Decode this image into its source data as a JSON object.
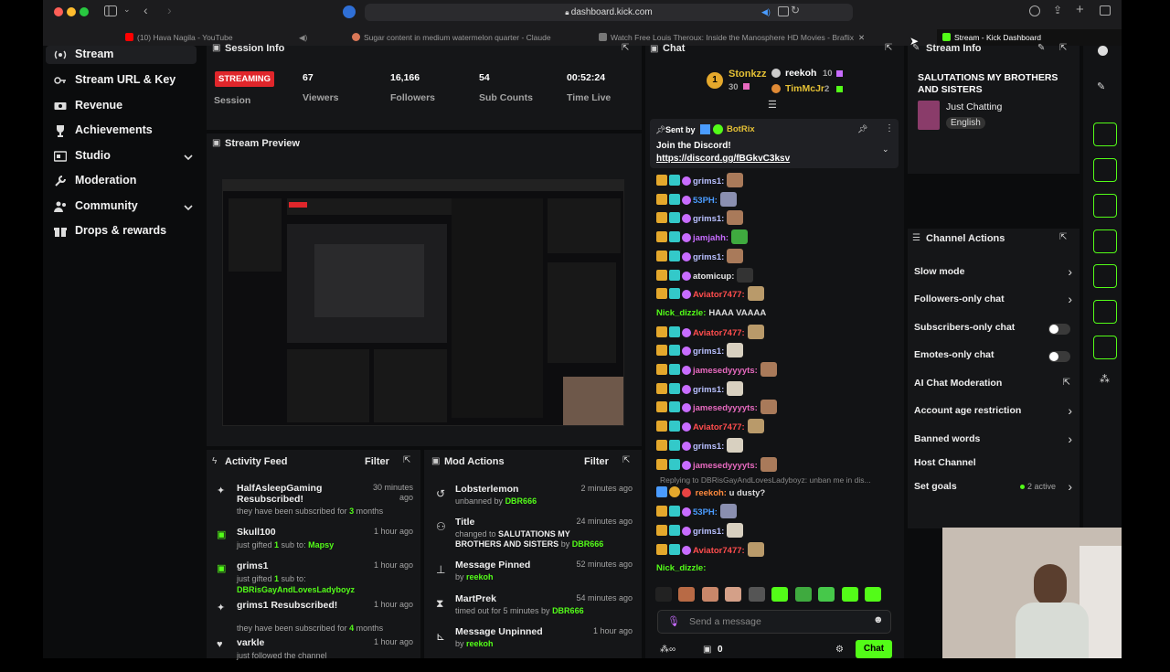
{
  "browser": {
    "url": "dashboard.kick.com",
    "tabs": [
      {
        "label": "(10) Hava Nagila - YouTube"
      },
      {
        "label": "Sugar content in medium watermelon quarter - Claude"
      },
      {
        "label": "Watch Free Louis Theroux: Inside the Manosphere HD Movies - Braflix"
      },
      {
        "label": "Stream - Kick Dashboard"
      }
    ]
  },
  "sidebar": {
    "items": [
      {
        "label": "Stream",
        "icon": "stream-icon"
      },
      {
        "label": "Stream URL & Key",
        "icon": "key-icon"
      },
      {
        "label": "Revenue",
        "icon": "money-icon"
      },
      {
        "label": "Achievements",
        "icon": "trophy-icon"
      },
      {
        "label": "Studio",
        "icon": "studio-icon"
      },
      {
        "label": "Moderation",
        "icon": "wrench-icon"
      },
      {
        "label": "Community",
        "icon": "community-icon"
      },
      {
        "label": "Drops & rewards",
        "icon": "gift-icon"
      }
    ]
  },
  "session": {
    "title": "Session Info",
    "status": "STREAMING",
    "status_label": "Session",
    "stats": [
      {
        "value": "67",
        "label": "Viewers"
      },
      {
        "value": "16,166",
        "label": "Followers"
      },
      {
        "value": "54",
        "label": "Sub Counts"
      },
      {
        "value": "00:52:24",
        "label": "Time Live"
      }
    ]
  },
  "preview": {
    "title": "Stream Preview"
  },
  "activity": {
    "title": "Activity Feed",
    "filter": "Filter",
    "items": [
      {
        "name": "HalfAsleepGaming Resubscribed!",
        "pre": "they have been subscribed for ",
        "hl": "3",
        "post": " months",
        "time": "30 minutes ago"
      },
      {
        "name": "Skull100",
        "pre": "just gifted ",
        "hl": "1",
        "post": " sub to: ",
        "hl2": "Mapsy",
        "time": "1 hour ago"
      },
      {
        "name": "grims1",
        "pre": "just gifted ",
        "hl": "1",
        "post": " sub to:",
        "hl2": "DBRisGayAndLovesLadyboyz",
        "time": "1 hour ago"
      },
      {
        "name": "grims1 Resubscribed!",
        "pre": "they have been subscribed for ",
        "hl": "4",
        "post": " months",
        "time": "1 hour ago"
      },
      {
        "name": "varkle",
        "pre": "just followed the channel",
        "hl": "",
        "post": "",
        "time": "1 hour ago"
      }
    ]
  },
  "mod_actions": {
    "title": "Mod Actions",
    "filter": "Filter",
    "items": [
      {
        "name": "Lobsterlemon",
        "pre": "unbanned by ",
        "hl": "DBR666",
        "time": "2 minutes ago"
      },
      {
        "name": "Title",
        "pre": "changed to ",
        "mid": "SALUTATIONS MY BROTHERS AND SISTERS",
        "pre2": " by ",
        "hl": "DBR666",
        "time": "24 minutes ago"
      },
      {
        "name": "Message Pinned",
        "pre": "by ",
        "hl": "reekoh",
        "time": "52 minutes ago"
      },
      {
        "name": "MartPrek",
        "pre": "timed out for 5 minutes by ",
        "hl": "DBR666",
        "time": "54 minutes ago"
      },
      {
        "name": "Message Unpinned",
        "pre": "by ",
        "hl": "reekoh",
        "time": "1 hour ago"
      }
    ]
  },
  "chat": {
    "title": "Chat",
    "leaders": [
      {
        "rank": "1",
        "name": "Stonkzz",
        "count": "30"
      },
      {
        "name": "reekoh",
        "count": "10"
      },
      {
        "name": "TimMcJr",
        "count": "2"
      }
    ],
    "pinned": {
      "sent_by": "Sent by",
      "bot": "BotRix",
      "text": "Join the Discord!",
      "link": "https://discord.gg/fBGkvC3ksv"
    },
    "messages": [
      {
        "user": "grims1:",
        "color": "#b9c0ff",
        "emote": "#a97a5a"
      },
      {
        "user": "53PH:",
        "color": "#4a9cff",
        "emote": "#8a8fb0"
      },
      {
        "user": "grims1:",
        "color": "#b9c0ff",
        "emote": "#a97a5a"
      },
      {
        "user": "jamjahh:",
        "color": "#c86cff",
        "emote": "#3faa3f"
      },
      {
        "user": "grims1:",
        "color": "#b9c0ff",
        "emote": "#a97a5a"
      },
      {
        "user": "atomicup:",
        "color": "#e8e8e8",
        "emote": "#333"
      },
      {
        "user": "Aviator7477:",
        "color": "#ff4d4d",
        "emote": "#b99a6a"
      },
      {
        "user": "Nick_dizzle:",
        "color": "#53fc18",
        "text": "HAAA VAAAA"
      },
      {
        "user": "Aviator7477:",
        "color": "#ff4d4d",
        "emote": "#b99a6a"
      },
      {
        "user": "grims1:",
        "color": "#b9c0ff",
        "emote": "#d8d0c0"
      },
      {
        "user": "jamesedyyyyts:",
        "color": "#e86ac0",
        "emote": "#a97a5a"
      },
      {
        "user": "grims1:",
        "color": "#b9c0ff",
        "emote": "#d8d0c0"
      },
      {
        "user": "jamesedyyyyts:",
        "color": "#e86ac0",
        "emote": "#a97a5a"
      },
      {
        "user": "Aviator7477:",
        "color": "#ff4d4d",
        "emote": "#b99a6a"
      },
      {
        "user": "grims1:",
        "color": "#b9c0ff",
        "emote": "#d8d0c0"
      },
      {
        "user": "jamesedyyyyts:",
        "color": "#e86ac0",
        "emote": "#a97a5a"
      }
    ],
    "reply_to": "Replying to DBRisGayAndLovesLadyboyz: unban me in dis...",
    "reply_user": "reekoh:",
    "reply_text": "u dusty?",
    "messages2": [
      {
        "user": "53PH:",
        "color": "#4a9cff",
        "emote": "#8a8fb0"
      },
      {
        "user": "grims1:",
        "color": "#b9c0ff",
        "emote": "#d8d0c0"
      },
      {
        "user": "Aviator7477:",
        "color": "#ff4d4d",
        "emote": "#b99a6a"
      }
    ],
    "last_user": "Nick_dizzle:",
    "placeholder": "Send a message",
    "points": "0",
    "send": "Chat"
  },
  "stream_info": {
    "title": "Stream Info",
    "stream_title": "SALUTATIONS MY BROTHERS AND SISTERS",
    "category": "Just Chatting",
    "tag": "English"
  },
  "channel_actions": {
    "title": "Channel Actions",
    "items": [
      {
        "label": "Slow mode",
        "kind": "arrow"
      },
      {
        "label": "Followers-only chat",
        "kind": "arrow"
      },
      {
        "label": "Subscribers-only chat",
        "kind": "toggle"
      },
      {
        "label": "Emotes-only chat",
        "kind": "toggle"
      },
      {
        "label": "AI Chat Moderation",
        "kind": "link"
      },
      {
        "label": "Account age restriction",
        "kind": "arrow"
      },
      {
        "label": "Banned words",
        "kind": "arrow"
      },
      {
        "label": "Host Channel",
        "kind": "none"
      },
      {
        "label": "Set goals",
        "kind": "arrow",
        "extra": "2 active"
      }
    ]
  },
  "colors": {
    "accent": "#53fc18",
    "live": "#e0262b",
    "bg": "#0b0c0d",
    "panel": "#151618"
  }
}
